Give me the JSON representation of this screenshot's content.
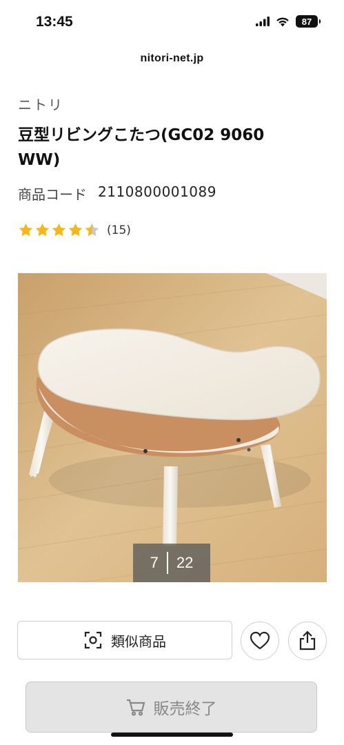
{
  "status_bar": {
    "time": "13:45",
    "battery": "87"
  },
  "browser": {
    "url": "nitori-net.jp"
  },
  "product": {
    "brand": "ニトリ",
    "title": "豆型リビングこたつ(GC02 9060 WW)",
    "code_label": "商品コード",
    "code_value": "2110800001089",
    "rating": 4.5,
    "review_count": "(15)"
  },
  "gallery": {
    "current": "7",
    "total": "22"
  },
  "actions": {
    "similar_label": "類似商品",
    "soldout_label": "販売終了"
  },
  "colors": {
    "star": "#f5b81c",
    "star_empty": "#c8c8c8"
  }
}
